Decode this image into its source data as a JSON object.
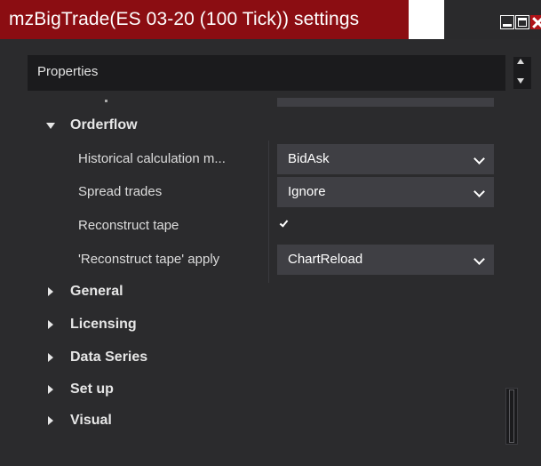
{
  "window": {
    "title": "mzBigTrade(ES 03-20 (100 Tick)) settings",
    "controls": [
      "minimize-icon",
      "maximize-icon",
      "close-icon"
    ],
    "colors": {
      "title_bg": "#8b0d12",
      "panel_bg": "#2b2b2d",
      "field_bg": "#3f3f44"
    }
  },
  "panel": {
    "header": "Properties"
  },
  "orderflow": {
    "title": "Orderflow",
    "rows": [
      {
        "label": "Historical calculation m...",
        "value": "BidAsk",
        "type": "dropdown"
      },
      {
        "label": "Spread trades",
        "value": "Ignore",
        "type": "dropdown"
      },
      {
        "label": "Reconstruct tape",
        "value": true,
        "type": "checkbox"
      },
      {
        "label": "'Reconstruct tape' apply",
        "value": "ChartReload",
        "type": "dropdown"
      }
    ]
  },
  "sections": [
    {
      "title": "General"
    },
    {
      "title": "Licensing"
    },
    {
      "title": "Data Series"
    },
    {
      "title": "Set up"
    },
    {
      "title": "Visual"
    }
  ]
}
